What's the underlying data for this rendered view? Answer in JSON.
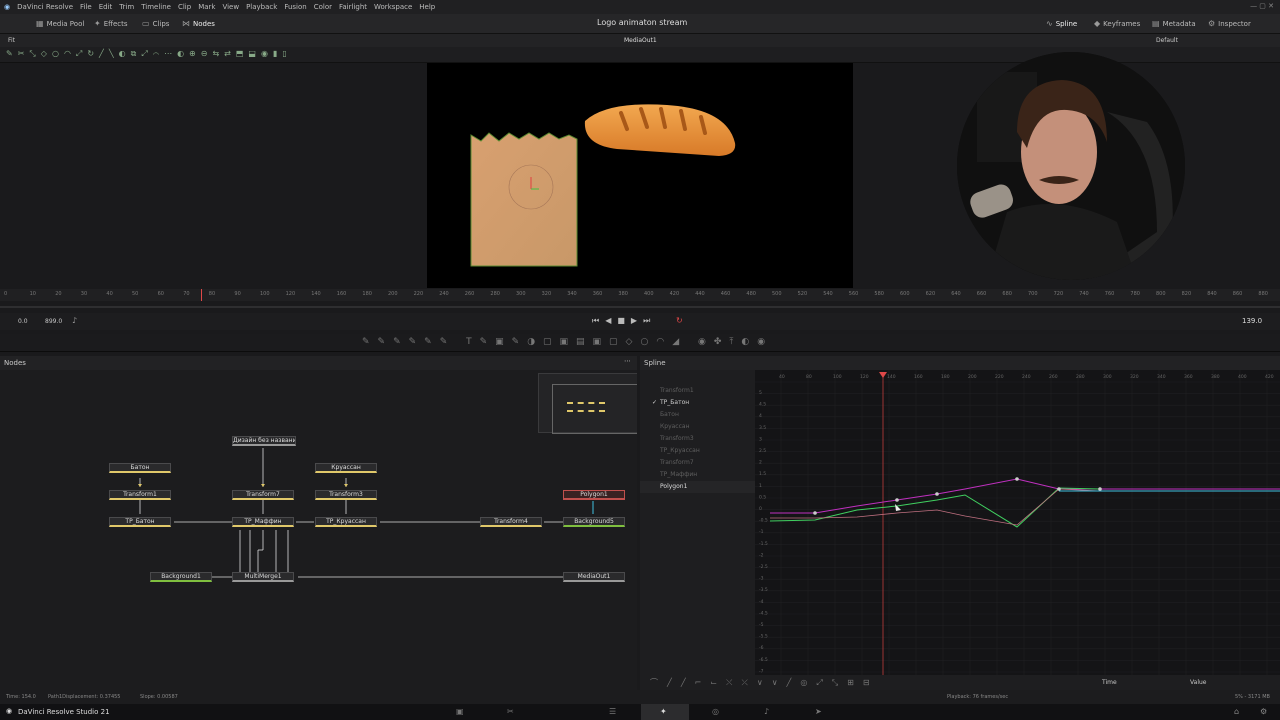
{
  "menubar": {
    "app": "DaVinci Resolve",
    "items": [
      "File",
      "Edit",
      "Trim",
      "Timeline",
      "Clip",
      "Mark",
      "View",
      "Playback",
      "Fusion",
      "Color",
      "Fairlight",
      "Workspace",
      "Help"
    ]
  },
  "toolbar": {
    "media_pool": "Media Pool",
    "effects": "Effects",
    "clips": "Clips",
    "nodes": "Nodes",
    "project_title": "Logo animaton stream",
    "spline": "Spline",
    "keyframes": "Keyframes",
    "metadata": "Metadata",
    "inspector": "Inspector"
  },
  "viewer": {
    "fit": "Fit",
    "output_label": "MediaOut1",
    "layout": "Default"
  },
  "ruler_ticks": [
    "0",
    "10",
    "20",
    "30",
    "40",
    "50",
    "60",
    "70",
    "80",
    "90",
    "100",
    "120",
    "140",
    "160",
    "180",
    "200",
    "220",
    "240",
    "260",
    "280",
    "300",
    "320",
    "340",
    "360",
    "380",
    "400",
    "420",
    "440",
    "460",
    "480",
    "500",
    "520",
    "540",
    "560",
    "580",
    "600",
    "620",
    "640",
    "660",
    "680",
    "700",
    "720",
    "740",
    "760",
    "780",
    "800",
    "820",
    "840",
    "860",
    "880"
  ],
  "transport": {
    "start": "0.0",
    "end": "899.0",
    "current": "139.0"
  },
  "nodes_panel": {
    "title": "Nodes",
    "nodes": {
      "design": "Дизайн без названи...",
      "baton": "Батон",
      "kruassan": "Круассан",
      "transform1": "Transform1",
      "transform7": "Transform7",
      "transform3": "Transform3",
      "polygon1": "Polygon1",
      "tp_baton": "TP_Батон",
      "tp_maffin": "TP_Маффин",
      "tp_kruassan": "TP_Круассан",
      "transform4": "Transform4",
      "background5": "Background5",
      "background1": "Background1",
      "multimerge1": "MultiMerge1",
      "mediaout1": "MediaOut1"
    }
  },
  "spline_panel": {
    "title": "Spline",
    "tree": [
      "Transform1",
      "TP_Батон",
      "Батон",
      "Круассан",
      "Transform3",
      "TP_Круассан",
      "Transform7",
      "TP_Маффин",
      "Polygon1"
    ],
    "y_ticks": [
      "5",
      "4.5",
      "4",
      "3.5",
      "3",
      "2.5",
      "2",
      "1.5",
      "1",
      "0.5",
      "0",
      "-0.5",
      "-1",
      "-1.5",
      "-2",
      "-2.5",
      "-3",
      "-3.5",
      "-4",
      "-4.5",
      "-5",
      "-5.5",
      "-6",
      "-6.5",
      "-7"
    ],
    "x_ticks": [
      "40",
      "80",
      "100",
      "120",
      "140",
      "160",
      "180",
      "200",
      "220",
      "240",
      "260",
      "280",
      "300",
      "320",
      "340",
      "360",
      "380",
      "400",
      "420"
    ],
    "time_label": "Time",
    "value_label": "Value"
  },
  "status": {
    "time": "Time: 154.0",
    "path": "Path1Displacement: 0.37455",
    "slope": "Slope: 0.00587",
    "playback": "Playback: 76 frames/sec",
    "memory": "5% - 3171 MB"
  },
  "bottom": {
    "app_name": "DaVinci Resolve Studio 21"
  },
  "colors": {
    "accent": "#e0c86a",
    "playhead": "#e04848",
    "magenta": "#c030c0",
    "green": "#40d060",
    "cyan": "#40c0e0"
  }
}
